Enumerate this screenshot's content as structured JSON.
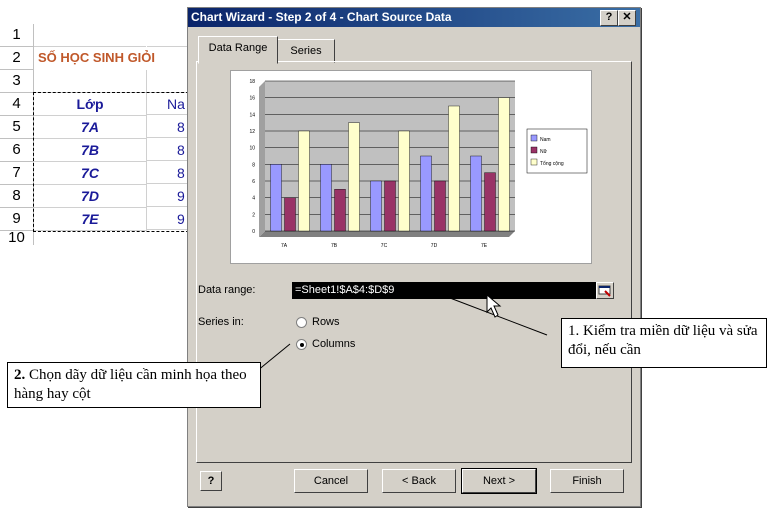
{
  "sheet": {
    "row_numbers": [
      "1",
      "2",
      "3",
      "4",
      "5",
      "6",
      "7",
      "8",
      "9",
      "10"
    ],
    "title": "SỐ HỌC SINH GIỎI",
    "header_a": "Lớp",
    "header_b": "Na",
    "rows": [
      {
        "class": "7A",
        "value": "8"
      },
      {
        "class": "7B",
        "value": "8"
      },
      {
        "class": "7C",
        "value": "8"
      },
      {
        "class": "7D",
        "value": "9"
      },
      {
        "class": "7E",
        "value": "9"
      }
    ]
  },
  "dialog": {
    "title": "Chart Wizard - Step 2 of 4 - Chart Source Data",
    "help_btn": "?",
    "close_btn": "✕",
    "tabs": [
      "Data Range",
      "Series"
    ],
    "data_range_label": "Data range:",
    "data_range_value": "=Sheet1!$A$4:$D$9",
    "series_in_label": "Series in:",
    "series_options": [
      "Rows",
      "Columns"
    ],
    "series_selected": "Columns",
    "buttons": {
      "help": "?",
      "cancel": "Cancel",
      "back": "< Back",
      "next": "Next >",
      "finish": "Finish"
    }
  },
  "chart_data": {
    "type": "bar",
    "categories": [
      "7A",
      "7B",
      "7C",
      "7D",
      "7E"
    ],
    "series": [
      {
        "name": "Nam",
        "values": [
          8,
          8,
          6,
          9,
          9
        ],
        "color": "#9999ff"
      },
      {
        "name": "Nữ",
        "values": [
          4,
          5,
          6,
          6,
          7
        ],
        "color": "#993366"
      },
      {
        "name": "Tổng cộng",
        "values": [
          12,
          13,
          12,
          15,
          16
        ],
        "color": "#ffffcc"
      }
    ],
    "yticks": [
      "0",
      "2",
      "4",
      "6",
      "8",
      "10",
      "12",
      "14",
      "16",
      "18"
    ],
    "ylim": [
      0,
      18
    ],
    "grid": true,
    "legend": "right",
    "plot_bg": "#c0c0c0"
  },
  "callouts": {
    "one": "1. Kiểm tra miền dữ liệu và sửa đổi, nếu cần",
    "two_num": "2.",
    "two_text": "Chọn dãy dữ liệu cần minh họa theo hàng hay cột"
  },
  "colors": {
    "titlebar": "#0a246a",
    "dialog_bg": "#d4d0c8",
    "sheet_text": "#1a1a99",
    "sheet_title": "#c0582a"
  }
}
